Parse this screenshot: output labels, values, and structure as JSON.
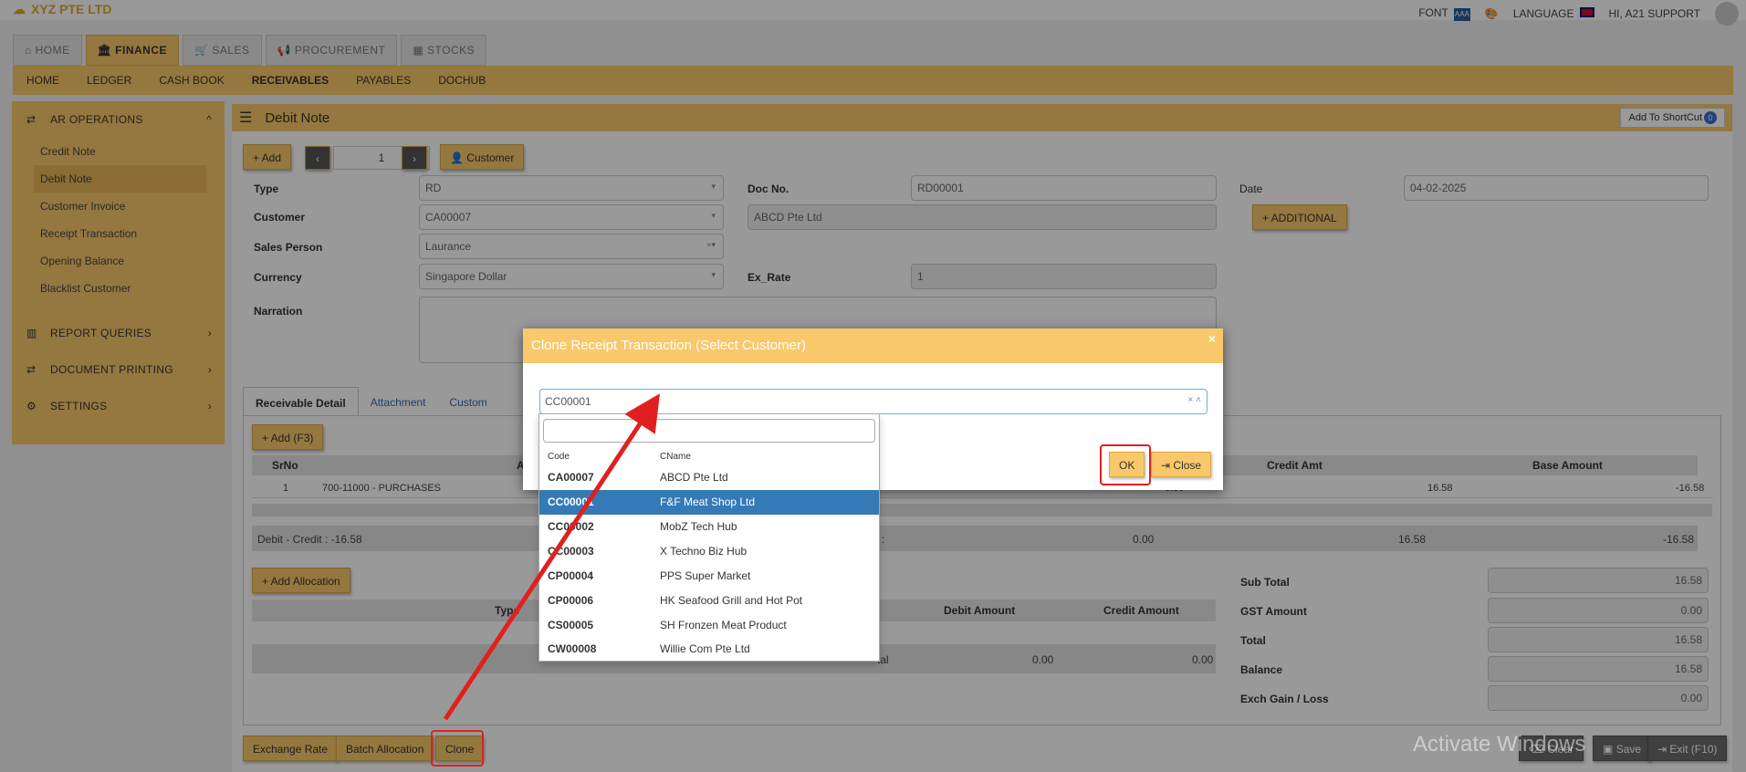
{
  "brand": "XYZ PTE LTD",
  "topright": {
    "font": "FONT",
    "font_icon": "AAA",
    "language": "LANGUAGE",
    "user": "HI, A21 SUPPORT"
  },
  "module_tabs": [
    {
      "label": "HOME",
      "icon": "⌂"
    },
    {
      "label": "FINANCE",
      "icon": "🏛"
    },
    {
      "label": "SALES",
      "icon": "🛒"
    },
    {
      "label": "PROCUREMENT",
      "icon": "📢"
    },
    {
      "label": "STOCKS",
      "icon": "▦"
    }
  ],
  "subnav": [
    "HOME",
    "LEDGER",
    "CASH BOOK",
    "RECEIVABLES",
    "PAYABLES",
    "DOCHUB"
  ],
  "sidebar": {
    "ar_operations": "AR OPERATIONS",
    "items": [
      "Credit Note",
      "Debit Note",
      "Customer Invoice",
      "Receipt Transaction",
      "Opening Balance",
      "Blacklist Customer"
    ],
    "report_queries": "REPORT QUERIES",
    "document_printing": "DOCUMENT PRINTING",
    "settings": "SETTINGS"
  },
  "panel": {
    "title": "Debit Note",
    "shortcut": "Add To ShortCut",
    "shortcut_count": "0"
  },
  "toolbar": {
    "add": "+ Add",
    "page": "1",
    "customer": "Customer",
    "additional": "+ ADDITIONAL"
  },
  "form": {
    "type_label": "Type",
    "type_value": "RD",
    "customer_label": "Customer",
    "customer_value": "CA00007",
    "customer_name": "ABCD Pte Ltd",
    "salesperson_label": "Sales Person",
    "salesperson_value": "Laurance",
    "currency_label": "Currency",
    "currency_value": "Singapore Dollar",
    "narration_label": "Narration",
    "docno_label": "Doc No.",
    "docno_value": "RD00001",
    "exrate_label": "Ex_Rate",
    "exrate_value": "1",
    "date_label": "Date",
    "date_value": "04-02-2025"
  },
  "tabs": [
    "Receivable Detail",
    "Attachment",
    "Custom"
  ],
  "detail": {
    "add_button": "+ Add (F3)",
    "headers": {
      "srno": "SrNo",
      "a": "A",
      "credit": "Credit Amt",
      "base": "Base Amount"
    },
    "row": {
      "srno": "1",
      "account": "700-11000 - PURCHASES",
      "debit": "0.00",
      "credit": "16.58",
      "base": "-16.58"
    },
    "summary": {
      "label": "Debit - Credit : -16.58",
      "colon": ":",
      "v1": "0.00",
      "v2": "16.58",
      "v3": "-16.58"
    }
  },
  "allocation": {
    "add_button": "+ Add Allocation",
    "headers": {
      "type": "Type",
      "debit": "Debit Amount",
      "credit": "Credit Amount"
    },
    "total": {
      "label": "tal",
      "debit": "0.00",
      "credit": "0.00"
    }
  },
  "totals": [
    {
      "label": "Sub Total",
      "value": "16.58"
    },
    {
      "label": "GST Amount",
      "value": "0.00"
    },
    {
      "label": "Total",
      "value": "16.58"
    },
    {
      "label": "Balance",
      "value": "16.58"
    },
    {
      "label": "Exch Gain / Loss",
      "value": "0.00"
    }
  ],
  "bottom_buttons": {
    "exchange_rate": "Exchange Rate",
    "batch_allocation": "Batch Allocation",
    "clone": "Clone",
    "clear": "Clear",
    "save": "Save",
    "exit": "Exit (F10)"
  },
  "watermark": "Activate Windows",
  "modal": {
    "title": "Clone Receipt Transaction (Select Customer)",
    "close_x": "×",
    "selected": "CC00001",
    "ok": "OK",
    "close": "Close",
    "dropdown_headers": {
      "code": "Code",
      "name": "CName"
    },
    "options": [
      {
        "code": "CA00007",
        "name": "ABCD Pte Ltd"
      },
      {
        "code": "CC00001",
        "name": "F&F Meat Shop Ltd"
      },
      {
        "code": "CC00002",
        "name": "MobZ Tech Hub"
      },
      {
        "code": "CC00003",
        "name": "X Techno Biz Hub"
      },
      {
        "code": "CP00004",
        "name": "PPS Super Market"
      },
      {
        "code": "CP00006",
        "name": "HK Seafood Grill and Hot Pot"
      },
      {
        "code": "CS00005",
        "name": "SH Fronzen Meat Product"
      },
      {
        "code": "CW00008",
        "name": "Willie Com Pte Ltd"
      }
    ],
    "selected_index": 1
  }
}
